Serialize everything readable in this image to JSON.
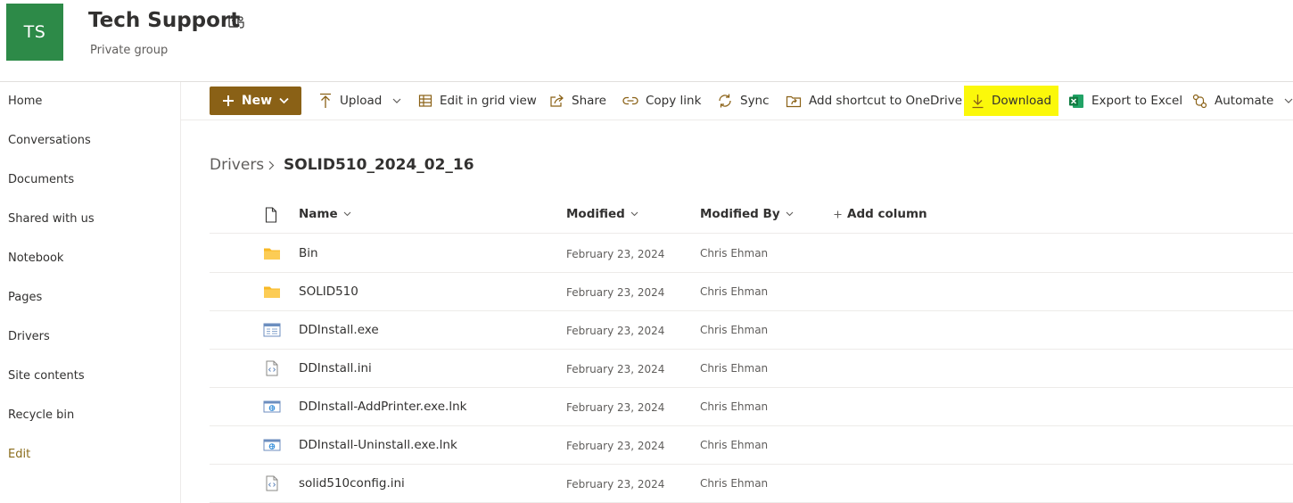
{
  "site": {
    "logo_initials": "TS",
    "title": "Tech Support",
    "subtitle": "Private group",
    "brand_color": "#2d8a48"
  },
  "nav": {
    "items": [
      "Home",
      "Conversations",
      "Documents",
      "Shared with us",
      "Notebook",
      "Pages",
      "Drivers",
      "Site contents",
      "Recycle bin"
    ],
    "edit_label": "Edit"
  },
  "commands": {
    "new_label": "New",
    "upload": "Upload",
    "grid": "Edit in grid view",
    "share": "Share",
    "copy_link": "Copy link",
    "sync": "Sync",
    "shortcut": "Add shortcut to OneDrive",
    "download": "Download",
    "export": "Export to Excel",
    "automate": "Automate",
    "accent_color": "#8a6116",
    "highlight_color": "#fbf80a"
  },
  "breadcrumb": {
    "parent": "Drivers",
    "current": "SOLID510_2024_02_16"
  },
  "columns": {
    "name": "Name",
    "modified": "Modified",
    "modified_by": "Modified By",
    "add_column": "Add column"
  },
  "files": [
    {
      "name": "Bin",
      "modified": "February 23, 2024",
      "modified_by": "Chris Ehman",
      "icon": "folder-icon"
    },
    {
      "name": "SOLID510",
      "modified": "February 23, 2024",
      "modified_by": "Chris Ehman",
      "icon": "folder-icon"
    },
    {
      "name": "DDInstall.exe",
      "modified": "February 23, 2024",
      "modified_by": "Chris Ehman",
      "icon": "exe-file-icon"
    },
    {
      "name": "DDInstall.ini",
      "modified": "February 23, 2024",
      "modified_by": "Chris Ehman",
      "icon": "code-file-icon"
    },
    {
      "name": "DDInstall-AddPrinter.exe.lnk",
      "modified": "February 23, 2024",
      "modified_by": "Chris Ehman",
      "icon": "link-file-icon"
    },
    {
      "name": "DDInstall-Uninstall.exe.lnk",
      "modified": "February 23, 2024",
      "modified_by": "Chris Ehman",
      "icon": "link-file-icon"
    },
    {
      "name": "solid510config.ini",
      "modified": "February 23, 2024",
      "modified_by": "Chris Ehman",
      "icon": "code-file-icon"
    }
  ]
}
